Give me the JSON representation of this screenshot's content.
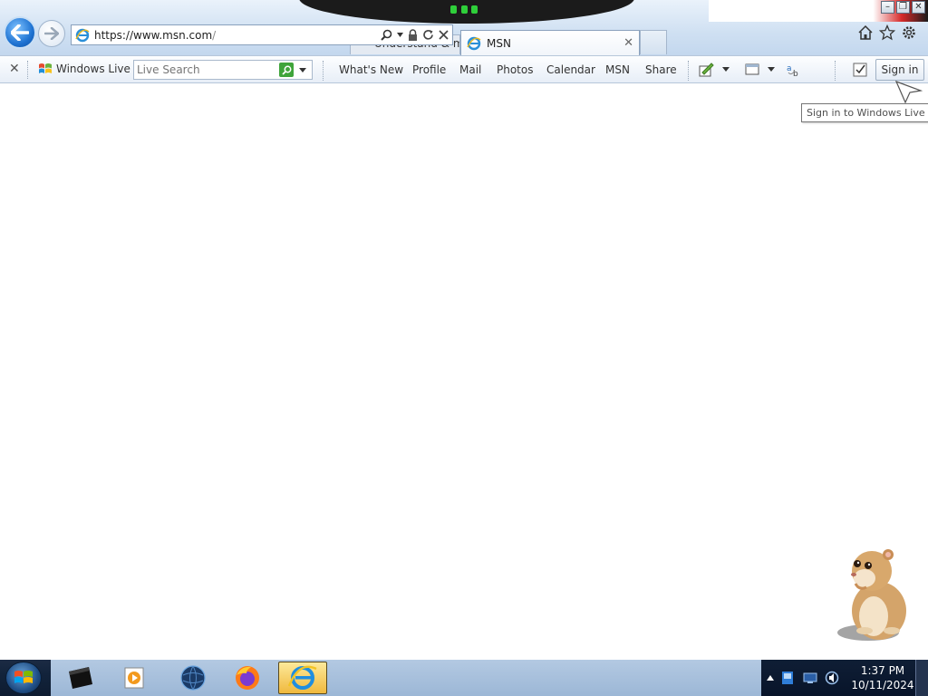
{
  "browser": {
    "address_url_prefix": "https://www.",
    "address_url_host": "msn.com",
    "address_url_suffix": "/",
    "tabs": [
      {
        "label": "Understand & ma",
        "active": false
      },
      {
        "label": "MSN",
        "active": true
      }
    ]
  },
  "toolbar": {
    "brand": "Windows Live",
    "search_placeholder": "Live Search",
    "links": [
      "What's New",
      "Profile",
      "Mail",
      "Photos",
      "Calendar",
      "MSN",
      "Share"
    ],
    "signin_label": "Sign in"
  },
  "tooltip": {
    "text": "Sign in to Windows Live"
  },
  "taskbar": {
    "apps": [
      "terminal-icon",
      "media-player-icon",
      "globe-icon",
      "firefox-icon",
      "internet-explorer-icon"
    ],
    "clock_time": "1:37 PM",
    "clock_date": "10/11/2024"
  },
  "colors": {
    "accent": "#1f73d2",
    "taskbar": "#12233b",
    "search_go": "#3fa43a"
  }
}
